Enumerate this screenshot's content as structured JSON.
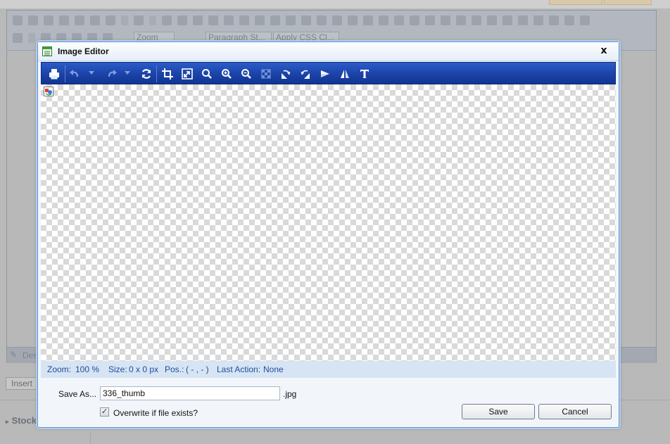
{
  "background": {
    "toolbar_row2": {
      "zoom_select": "Zoom",
      "paragraph_select": "Paragraph St...",
      "css_select": "Apply CSS Cl..."
    },
    "status_mode": "Des",
    "insert_button": "Insert",
    "section_title": "Stock"
  },
  "dialog": {
    "title": "Image Editor",
    "close_label": "x",
    "toolbar": [
      {
        "name": "print-icon",
        "title": "Print"
      },
      {
        "name": "undo-icon",
        "title": "Undo"
      },
      {
        "name": "redo-icon",
        "title": "Redo"
      },
      {
        "name": "reset-icon",
        "title": "Reset"
      },
      {
        "name": "crop-icon",
        "title": "Crop"
      },
      {
        "name": "resize-icon",
        "title": "Resize"
      },
      {
        "name": "zoom-icon",
        "title": "Zoom"
      },
      {
        "name": "zoom-in-icon",
        "title": "Zoom In"
      },
      {
        "name": "zoom-out-icon",
        "title": "Zoom Out"
      },
      {
        "name": "opacity-icon",
        "title": "Opacity"
      },
      {
        "name": "rotate-right-icon",
        "title": "Rotate Right"
      },
      {
        "name": "rotate-left-icon",
        "title": "Rotate Left"
      },
      {
        "name": "flip-icon",
        "title": "Flip"
      },
      {
        "name": "flip-vertical-icon",
        "title": "Flip Vertical"
      },
      {
        "name": "add-text-icon",
        "title": "Add Text"
      }
    ],
    "status": {
      "zoom_label": "Zoom:",
      "zoom_value": "100 %",
      "size_label": "Size:",
      "size_value": "0 x 0 px",
      "pos_label": "Pos.:",
      "pos_value": "( - , - )",
      "action_label": "Last Action:",
      "action_value": "None"
    },
    "save_as_label": "Save As...",
    "filename": "336_thumb",
    "extension": ".jpg",
    "overwrite_checked": true,
    "overwrite_label": "Overwrite if file exists?",
    "save_button": "Save",
    "cancel_button": "Cancel"
  }
}
